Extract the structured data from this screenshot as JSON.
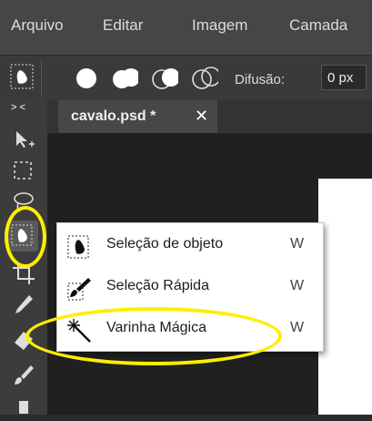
{
  "menubar": {
    "items": [
      "Arquivo",
      "Editar",
      "Imagem",
      "Camada"
    ]
  },
  "options": {
    "feather_label": "Difusão:",
    "feather_value": "0 px"
  },
  "toolbar": {
    "collapse_label": "> <"
  },
  "document": {
    "tab_title": "cavalo.psd *",
    "close_glyph": "✕"
  },
  "popup": {
    "items": [
      {
        "label": "Seleção de objeto",
        "shortcut": "W"
      },
      {
        "label": "Seleção Rápida",
        "shortcut": "W"
      },
      {
        "label": "Varinha Mágica",
        "shortcut": "W"
      }
    ]
  },
  "colors": {
    "highlight": "#ffee00",
    "menubar": "#464646",
    "toolbar": "#3c3c3c"
  }
}
